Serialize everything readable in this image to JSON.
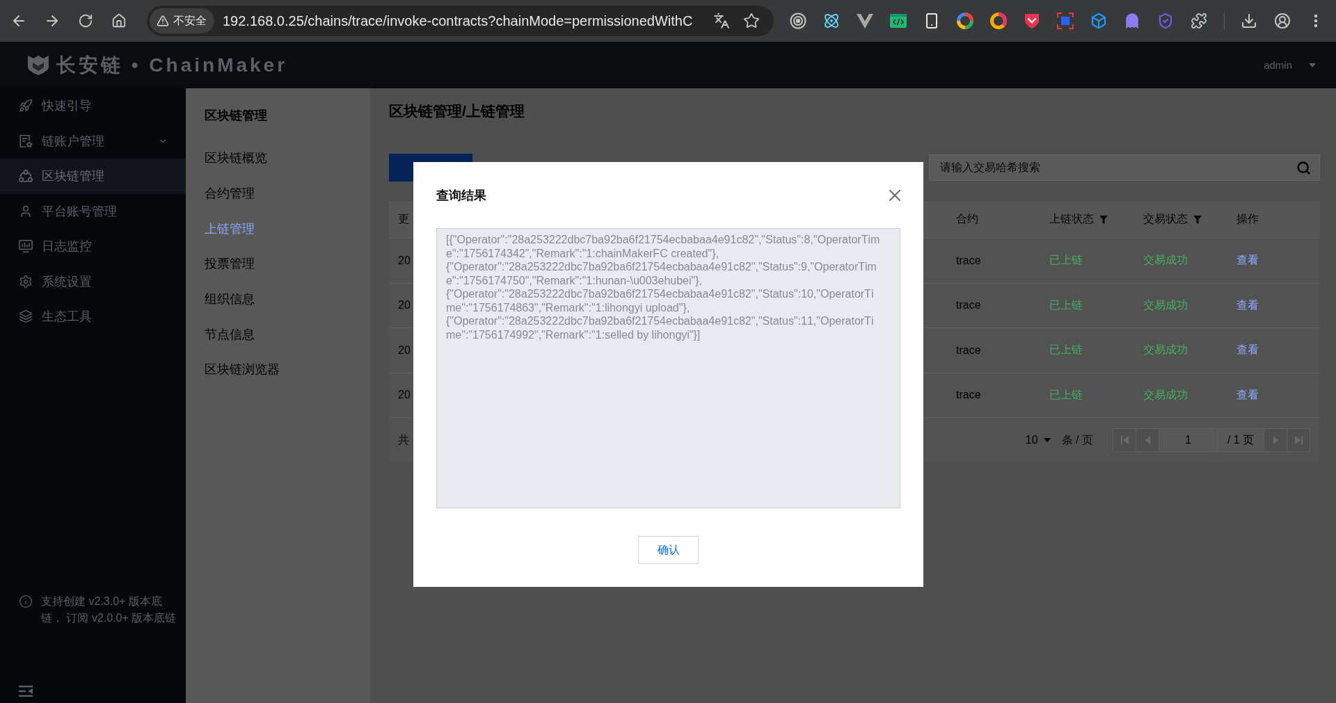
{
  "browser": {
    "security_label": "不安全",
    "url": "192.168.0.25/chains/trace/invoke-contracts?chainMode=permissionedWithC"
  },
  "header": {
    "logo": "长安链 • ChainMaker",
    "user": "admin"
  },
  "sidebar": {
    "items": [
      {
        "label": "快速引导",
        "kind": "link",
        "selected": false
      },
      {
        "label": "链账户管理",
        "kind": "group",
        "selected": false
      },
      {
        "label": "区块链管理",
        "kind": "link",
        "selected": true
      },
      {
        "label": "平台账号管理",
        "kind": "link",
        "selected": false
      },
      {
        "label": "日志监控",
        "kind": "link",
        "selected": false
      },
      {
        "label": "系统设置",
        "kind": "link",
        "selected": false
      },
      {
        "label": "生态工具",
        "kind": "link",
        "selected": false
      }
    ],
    "note": "支持创建 v2.3.0+ 版本底链， 订阅 v2.0.0+ 版本底链"
  },
  "submenu": {
    "title": "区块链管理",
    "items": [
      {
        "label": "区块链概览",
        "selected": false
      },
      {
        "label": "合约管理",
        "selected": false
      },
      {
        "label": "上链管理",
        "selected": true
      },
      {
        "label": "投票管理",
        "selected": false
      },
      {
        "label": "组织信息",
        "selected": false
      },
      {
        "label": "节点信息",
        "selected": false
      },
      {
        "label": "区块链浏览器",
        "selected": false
      }
    ]
  },
  "page": {
    "title": "区块链管理/上链管理",
    "search": {
      "placeholder": "请输入交易哈希搜索"
    },
    "table": {
      "columns": [
        {
          "label": "更",
          "kind": "text",
          "filter": false
        },
        {
          "label": "合约",
          "kind": "text",
          "filter": false
        },
        {
          "label": "上链状态",
          "kind": "status",
          "filter": true
        },
        {
          "label": "交易状态",
          "kind": "status",
          "filter": true
        },
        {
          "label": "操作",
          "kind": "link",
          "filter": false
        }
      ],
      "rows": [
        {
          "cells": [
            "20",
            "trace",
            "已上链",
            "交易成功",
            "查看"
          ]
        },
        {
          "cells": [
            "20",
            "trace",
            "已上链",
            "交易成功",
            "查看"
          ]
        },
        {
          "cells": [
            "20",
            "trace",
            "已上链",
            "交易成功",
            "查看"
          ]
        },
        {
          "cells": [
            "20",
            "trace",
            "已上链",
            "交易成功",
            "查看"
          ]
        }
      ]
    },
    "footer": {
      "total": "共",
      "page_size": "10",
      "page_size_unit": "条 / 页",
      "page": "1",
      "page_count": "/ 1 页",
      "pager_buttons": [
        {
          "kind": "first",
          "disabled": true
        },
        {
          "kind": "prev",
          "disabled": true
        },
        {
          "kind": "next",
          "disabled": true
        },
        {
          "kind": "last",
          "disabled": true
        }
      ]
    }
  },
  "modal": {
    "title": "查询结果",
    "result": {
      "value": "[{\"Operator\":\"28a253222dbc7ba92ba6f21754ecbabaa4e91c82\",\"Status\":8,\"OperatorTime\":\"1756174342\",\"Remark\":\"1:chainMakerFC created\"},{\"Operator\":\"28a253222dbc7ba92ba6f21754ecbabaa4e91c82\",\"Status\":9,\"OperatorTime\":\"1756174750\",\"Remark\":\"1:hunan-\\u003ehubei\"},{\"Operator\":\"28a253222dbc7ba92ba6f21754ecbabaa4e91c82\",\"Status\":10,\"OperatorTime\":\"1756174863\",\"Remark\":\"1:lihongyi upload\"},{\"Operator\":\"28a253222dbc7ba92ba6f21754ecbabaa4e91c82\",\"Status\":11,\"OperatorTime\":\"1756174992\",\"Remark\":\"1:selled by lihongyi\"}]",
      "disabled": true
    },
    "confirm": "确认"
  }
}
